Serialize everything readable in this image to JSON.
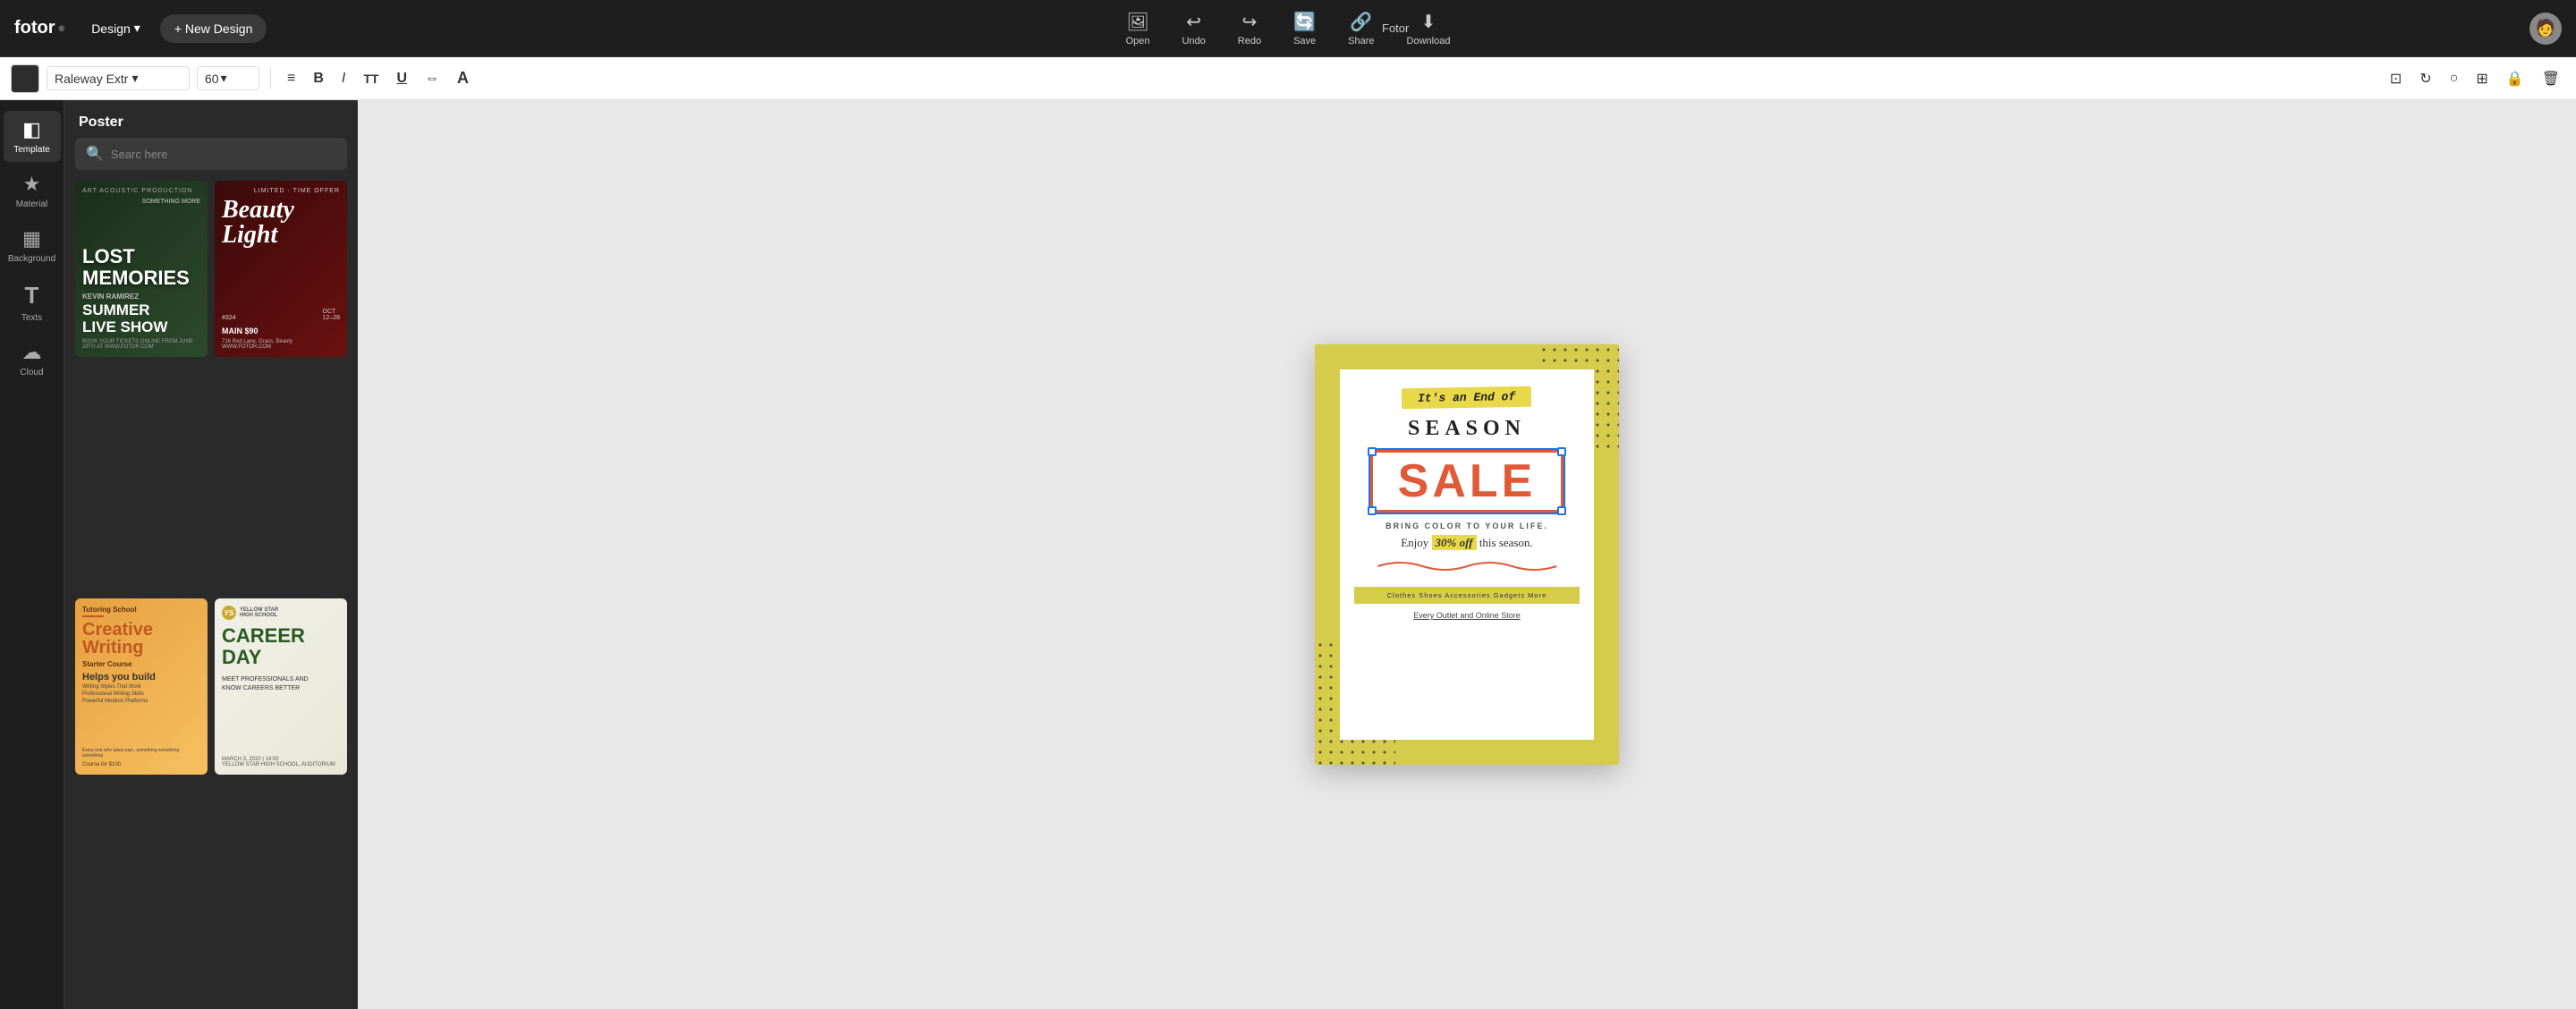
{
  "app": {
    "logo": "fotor",
    "logo_superscript": "®"
  },
  "top_bar": {
    "design_label": "Design",
    "new_design_label": "+ New Design",
    "toolbar_items": [
      {
        "id": "open",
        "icon": "🖼",
        "label": "Open"
      },
      {
        "id": "undo",
        "icon": "↩",
        "label": "Undo"
      },
      {
        "id": "redo",
        "icon": "↪",
        "label": "Redo"
      },
      {
        "id": "save",
        "icon": "🔄",
        "label": "Save"
      },
      {
        "id": "share",
        "icon": "🔗",
        "label": "Share"
      },
      {
        "id": "download",
        "icon": "⬇",
        "label": "Download"
      }
    ],
    "fotor_user": "Fotor",
    "avatar_emoji": "👤"
  },
  "format_bar": {
    "font_name": "Raleway Extr",
    "font_size": "60",
    "align_icon": "≡",
    "bold_label": "B",
    "italic_label": "I",
    "size_label": "TT",
    "underline_label": "U",
    "spacing_label": "⇔",
    "case_label": "A"
  },
  "sidebar": {
    "items": [
      {
        "id": "template",
        "icon": "◧",
        "label": "Template",
        "active": true
      },
      {
        "id": "material",
        "icon": "★",
        "label": "Material"
      },
      {
        "id": "background",
        "icon": "▦",
        "label": "Background"
      },
      {
        "id": "texts",
        "icon": "T",
        "label": "Texts"
      },
      {
        "id": "cloud",
        "icon": "☁",
        "label": "Cloud"
      }
    ]
  },
  "left_panel": {
    "title": "Poster",
    "search_placeholder": "Searc here",
    "templates": [
      {
        "id": "t1",
        "title": "Lost Memories\nSummer Live Show",
        "style": "dark-green"
      },
      {
        "id": "t2",
        "title": "Beauty Light\nLimited Time Offer",
        "style": "dark-red"
      },
      {
        "id": "t3",
        "title": "Creative Writing\nTutoring School",
        "style": "orange"
      },
      {
        "id": "t4",
        "title": "Career Day\nYellow Star High School",
        "style": "light"
      }
    ]
  },
  "canvas": {
    "poster": {
      "tag_text": "It's an End of",
      "season_text": "SEASON",
      "sale_text": "SALE",
      "bring_color": "BRING COLOR TO YOUR LIFE.",
      "enjoy_text": "Enjoy",
      "discount": "30% off",
      "this_season": "this season.",
      "categories": "Clothes  Shoes  Accessories  Gadgets  More",
      "store": "Every Outlet and Online Store"
    }
  }
}
